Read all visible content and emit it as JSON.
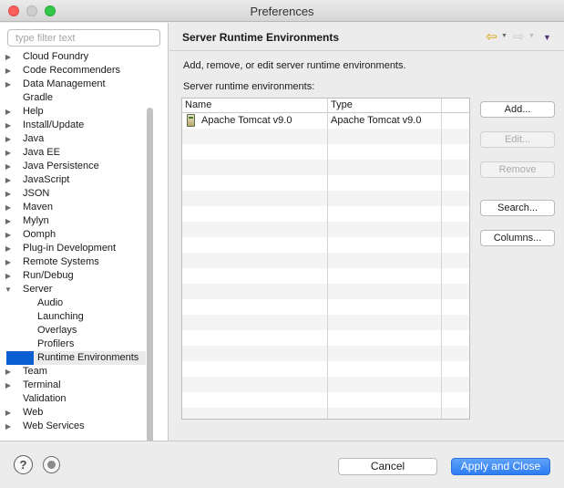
{
  "window": {
    "title": "Preferences"
  },
  "filter": {
    "placeholder": "type filter text",
    "value": ""
  },
  "tree": [
    {
      "label": "Cloud Foundry",
      "arrow": "right",
      "level": 0
    },
    {
      "label": "Code Recommenders",
      "arrow": "right",
      "level": 0
    },
    {
      "label": "Data Management",
      "arrow": "right",
      "level": 0
    },
    {
      "label": "Gradle",
      "arrow": "none",
      "level": 0
    },
    {
      "label": "Help",
      "arrow": "right",
      "level": 0
    },
    {
      "label": "Install/Update",
      "arrow": "right",
      "level": 0
    },
    {
      "label": "Java",
      "arrow": "right",
      "level": 0
    },
    {
      "label": "Java EE",
      "arrow": "right",
      "level": 0
    },
    {
      "label": "Java Persistence",
      "arrow": "right",
      "level": 0
    },
    {
      "label": "JavaScript",
      "arrow": "right",
      "level": 0
    },
    {
      "label": "JSON",
      "arrow": "right",
      "level": 0
    },
    {
      "label": "Maven",
      "arrow": "right",
      "level": 0
    },
    {
      "label": "Mylyn",
      "arrow": "right",
      "level": 0
    },
    {
      "label": "Oomph",
      "arrow": "right",
      "level": 0
    },
    {
      "label": "Plug-in Development",
      "arrow": "right",
      "level": 0
    },
    {
      "label": "Remote Systems",
      "arrow": "right",
      "level": 0
    },
    {
      "label": "Run/Debug",
      "arrow": "right",
      "level": 0
    },
    {
      "label": "Server",
      "arrow": "down",
      "level": 0
    },
    {
      "label": "Audio",
      "arrow": "none",
      "level": 1
    },
    {
      "label": "Launching",
      "arrow": "none",
      "level": 1
    },
    {
      "label": "Overlays",
      "arrow": "none",
      "level": 1
    },
    {
      "label": "Profilers",
      "arrow": "none",
      "level": 1
    },
    {
      "label": "Runtime Environments",
      "arrow": "none",
      "level": 1,
      "selected": true
    },
    {
      "label": "Team",
      "arrow": "right",
      "level": 0
    },
    {
      "label": "Terminal",
      "arrow": "right",
      "level": 0
    },
    {
      "label": "Validation",
      "arrow": "none",
      "level": 0
    },
    {
      "label": "Web",
      "arrow": "right",
      "level": 0
    },
    {
      "label": "Web Services",
      "arrow": "right",
      "level": 0
    }
  ],
  "page": {
    "title": "Server Runtime Environments",
    "description": "Add, remove, or edit server runtime environments.",
    "table_label": "Server runtime environments:"
  },
  "table": {
    "columns": [
      "Name",
      "Type"
    ],
    "rows": [
      {
        "name": "Apache Tomcat v9.0",
        "type": "Apache Tomcat v9.0",
        "icon": "server-runtime-icon"
      }
    ]
  },
  "buttons": {
    "add": "Add...",
    "edit": "Edit...",
    "remove": "Remove",
    "search": "Search...",
    "columns": "Columns..."
  },
  "footer": {
    "cancel": "Cancel",
    "apply_close": "Apply and Close"
  },
  "colors": {
    "accent": "#2d7cf2",
    "selection": "#0a5fd0"
  }
}
